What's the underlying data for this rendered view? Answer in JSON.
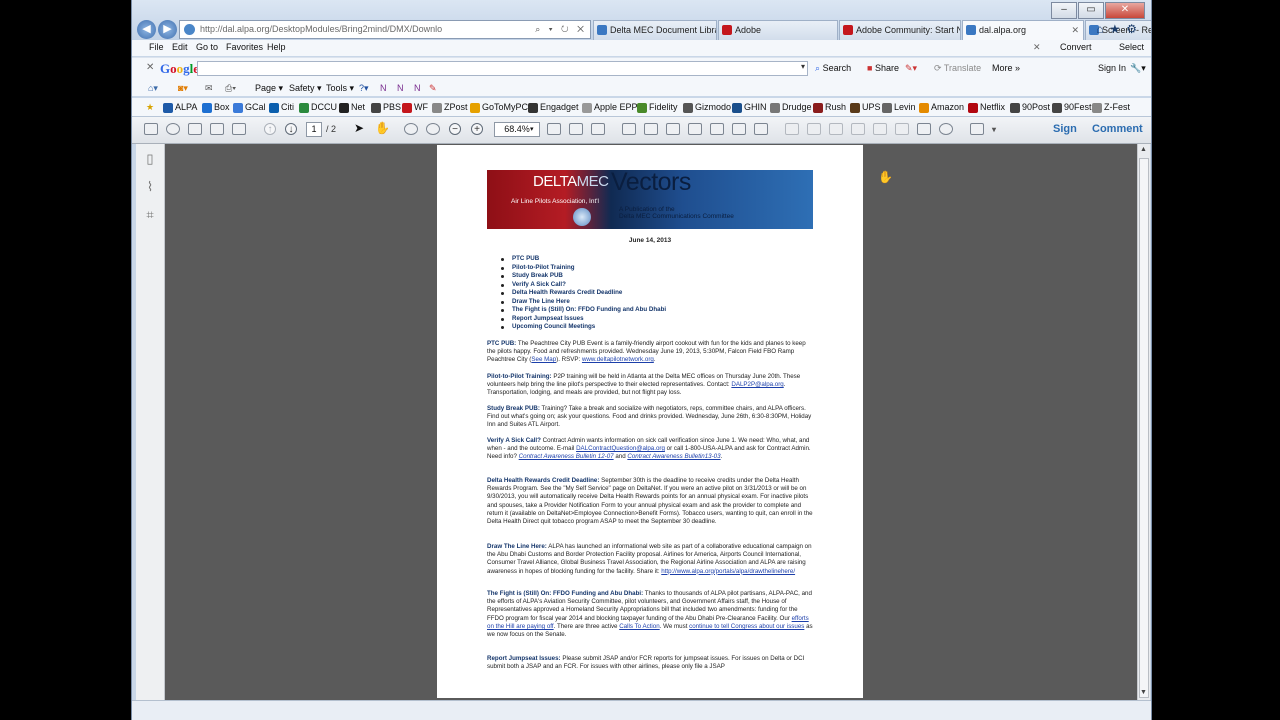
{
  "browser": {
    "address": "http://dal.alpa.org/DesktopModules/Bring2mind/DMX/Downlo",
    "address_tools": "⌕ ▾ ↻ ✕",
    "tabs": [
      {
        "label": "Delta MEC Document Library",
        "icon": "blue"
      },
      {
        "label": "Adobe",
        "icon": "red"
      },
      {
        "label": "Adobe Community: Start N...",
        "icon": "red"
      },
      {
        "label": "dal.alpa.org",
        "icon": "blue"
      },
      {
        "label": "Screenr - Record",
        "icon": "blue"
      }
    ],
    "tab_close": "✕",
    "window_buttons": [
      "–",
      "▭",
      "✕"
    ],
    "ie_icons": "⌂★⚙",
    "menu": [
      "File",
      "Edit",
      "Go to",
      "Favorites",
      "Help"
    ],
    "menu_right": {
      "close": "✕",
      "convert": "Convert",
      "select": "Select"
    },
    "google": {
      "close": "✕",
      "logo": "Google",
      "search": "Search",
      "share": "Share",
      "translate": "Translate",
      "more": "More »",
      "signin": "Sign In",
      "dd": "▾"
    },
    "command": {
      "page": "Page ▾",
      "safety": "Safety ▾",
      "tools": "Tools ▾",
      "help": "?▾"
    },
    "favorites": [
      "ALPA",
      "Box",
      "GCal",
      "Citi",
      "DCCU",
      "Net",
      "PBS",
      "WF",
      "ZPost",
      "GoToMyPC",
      "Engadget",
      "Apple EPP",
      "Fidelity",
      "Gizmodo",
      "GHIN",
      "Drudge",
      "Rush",
      "UPS",
      "Levin",
      "Amazon",
      "Netflix",
      "90Post",
      "90Fest",
      "Z-Fest"
    ]
  },
  "pdf_toolbar": {
    "page_number": "1",
    "page_total": "/ 2",
    "zoom": "68.4%",
    "zoom_dd": "▾",
    "zoom_out": "−",
    "zoom_in": "+",
    "sign": "Sign",
    "comment": "Comment"
  },
  "sidebar_icons": [
    "▯",
    "⌇",
    "⌗"
  ],
  "scroll": {
    "up": "▲",
    "down": "▼"
  },
  "cursor": "✋",
  "document": {
    "banner": {
      "delta": "DELTA",
      "mec": "MEC",
      "alpa": "Air Line Pilots Association, Int'l",
      "vectors": "Vectors",
      "sub1": "A Publication of the",
      "sub2": "Delta MEC Communications Committee"
    },
    "date": "June 14, 2013",
    "toc": [
      "PTC PUB",
      "Pilot-to-Pilot Training",
      "Study Break PUB",
      "Verify A Sick Call?",
      "Delta Health Rewards Credit Deadline",
      "Draw The Line Here",
      "The Fight is (Still) On: FFDO Funding and Abu Dhabi",
      "Report Jumpseat Issues",
      "Upcoming Council Meetings"
    ],
    "p1": {
      "h": "PTC PUB:",
      "t": " The Peachtree City PUB Event is a family-friendly airport cookout with fun for the kids and planes to keep the pilots happy. Food and refreshments provided. Wednesday June 19, 2013, 5:30PM, Falcon Field FBO Ramp Peachtree City (",
      "l1": "See Map",
      "t2": "). RSVP: ",
      "l2": "www.deltapilotnetwork.org",
      "t3": "."
    },
    "p2": {
      "h": "Pilot-to-Pilot Training:",
      "t": " P2P training will be held in Atlanta at the Delta MEC offices on Thursday June 20th. These volunteers help bring the line pilot's perspective to their elected representatives. Contact: ",
      "l1": "DALP2P@alpa.org",
      "t2": ". Transportation, lodging, and meals are provided, but not flight pay loss."
    },
    "p3": {
      "h": "Study Break PUB:",
      "t": " Training? Take a break and socialize with negotiators, reps, committee chairs, and ALPA officers. Find out what's going on; ask your questions. Food and drinks provided. Wednesday, June 26th, 6:30-8:30PM, Holiday Inn and Suites ATL Airport."
    },
    "p4": {
      "h": "Verify A Sick Call?",
      "t": " Contract Admin wants information on sick call verification since June 1. We need: Who, what, and when - and the outcome. E-mail ",
      "l1": "DALContractQuestion@alpa.org",
      "t2": " or call 1-800-USA-ALPA and ask for Contract Admin. Need info? ",
      "l2": "Contract Awareness Bulletin 12-07",
      "t3": " and ",
      "l3": "Contract Awareness Bulletin13-03",
      "t4": "."
    },
    "p5": {
      "h": "Delta Health Rewards Credit Deadline:",
      "t": " September 30th is the deadline to receive credits under the Delta Health Rewards Program. See the \"My Self Service\" page on DeltaNet. If you were an active pilot on 3/31/2013 or will be on 9/30/2013, you will automatically receive Delta Health Rewards points for an annual physical exam. For inactive pilots and spouses, take a Provider Notification Form to your annual physical exam and ask the provider to complete and return it (available on DeltaNet>Employee Connection>Benefit Forms). Tobacco users, wanting to quit, can enroll in the Delta Health Direct quit tobacco program ASAP to meet the September 30 deadline."
    },
    "p6": {
      "h": "Draw The Line Here:",
      "t": " ALPA has launched an informational web site as part of a collaborative educational campaign on the Abu Dhabi Customs and Border Protection Facility proposal. Airlines for America, Airports Council International, Consumer Travel Alliance, Global Business Travel Association, the Regional Airline Association and ALPA are raising awareness in hopes of blocking funding for the facility. Share it: ",
      "l1": "http://www.alpa.org/portals/alpa/drawthelinehere/"
    },
    "p7": {
      "h": "The Fight is (Still) On: FFDO Funding and Abu Dhabi:",
      "t": " Thanks to thousands of ALPA pilot partisans, ALPA-PAC, and the efforts of ALPA's Aviation Security Committee, pilot volunteers, and Government Affairs staff, the House of Representatives approved a Homeland Security Appropriations bill that included two amendments: funding for the FFDO program for fiscal year 2014 and blocking taxpayer funding of the Abu Dhabi Pre-Clearance Facility. Our ",
      "l1": "efforts on the Hill are paying off",
      "t2": ". There are three active ",
      "l2": "Calls To Action",
      "t3": ". We must ",
      "l3": "continue to tell Congress about our issues",
      "t4": " as we now focus on the Senate."
    },
    "p8": {
      "h": "Report Jumpseat Issues:",
      "t": " Please submit JSAP and/or FCR reports for jumpseat issues. For issues on Delta or DCI submit both a JSAP and an FCR. For issues with other airlines, please only file a JSAP"
    }
  }
}
